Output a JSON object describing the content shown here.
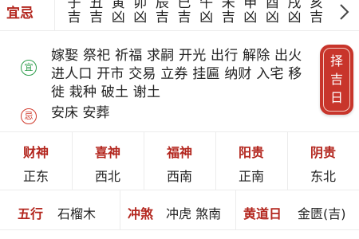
{
  "yiji_title": "宜忌",
  "hours": [
    {
      "ganzhi": "子",
      "jx": "吉"
    },
    {
      "ganzhi": "丑",
      "jx": "吉"
    },
    {
      "ganzhi": "寅",
      "jx": "凶"
    },
    {
      "ganzhi": "卯",
      "jx": "凶"
    },
    {
      "ganzhi": "辰",
      "jx": "吉"
    },
    {
      "ganzhi": "巳",
      "jx": "吉"
    },
    {
      "ganzhi": "午",
      "jx": "凶"
    },
    {
      "ganzhi": "未",
      "jx": "吉"
    },
    {
      "ganzhi": "申",
      "jx": "凶"
    },
    {
      "ganzhi": "酉",
      "jx": "凶"
    },
    {
      "ganzhi": "戌",
      "jx": "凶"
    },
    {
      "ganzhi": "亥",
      "jx": "吉"
    }
  ],
  "yi": {
    "badge": "宜",
    "text": "嫁娶 祭祀 祈福 求嗣 开光 出行 解除 出火 进人口 开市 交易 立券 挂匾 纳财 入宅 移徙 栽种 破土 谢土"
  },
  "ji": {
    "badge": "忌",
    "text": "安床 安葬"
  },
  "zeji_button": "择吉日",
  "gods": [
    {
      "title": "财神",
      "dir": "正东"
    },
    {
      "title": "喜神",
      "dir": "西北"
    },
    {
      "title": "福神",
      "dir": "西南"
    },
    {
      "title": "阳贵",
      "dir": "正南"
    },
    {
      "title": "阴贵",
      "dir": "东北"
    }
  ],
  "info": {
    "wuxing_label": "五行",
    "wuxing_value": "石榴木",
    "chongsha_label": "冲煞",
    "chongsha_value": "冲虎 煞南",
    "huangdao_label": "黄道日",
    "huangdao_value": "金匮(吉)"
  },
  "colors": {
    "accent": "#b3261e",
    "button": "#c8352b",
    "yi": "#2e9d4c",
    "ji": "#d0392b"
  }
}
